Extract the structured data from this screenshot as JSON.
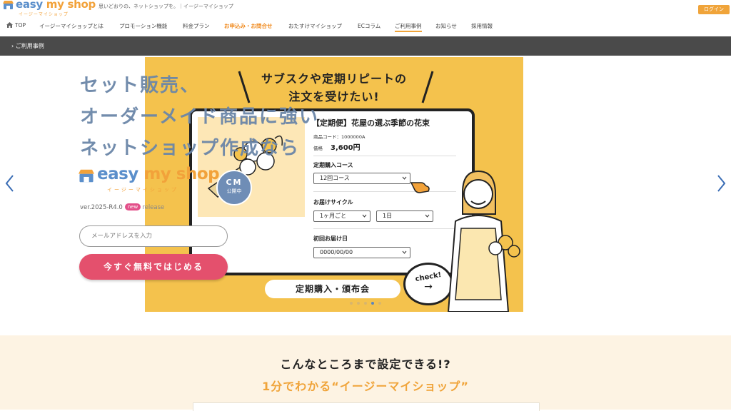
{
  "header": {
    "logo_text_a": "easy",
    "logo_text_b": "my shop",
    "logo_sub": "イージーマイショップ",
    "tagline": "思いどおりの、ネットショップを。｜イージーマイショップ",
    "login_label": "ログイン"
  },
  "nav": {
    "items": [
      {
        "label": "TOP"
      },
      {
        "label": "イージーマイショップとは"
      },
      {
        "label": "プロモーション機能"
      },
      {
        "label": "料金プラン"
      },
      {
        "label": "お申込み・お問合せ"
      },
      {
        "label": "おたすけマイショップ"
      },
      {
        "label": "ECコラム"
      },
      {
        "label": "ご利用事例"
      },
      {
        "label": "お知らせ"
      },
      {
        "label": "採用情報"
      }
    ],
    "active": "ご利用事例"
  },
  "breadcrumb": {
    "label": "ご利用事例"
  },
  "hero": {
    "title_lines": [
      "セット販売、",
      "オーダーメイド商品に強い",
      "ネットショップ作成なら"
    ],
    "logo_text_a": "easy",
    "logo_text_b": "my shop",
    "logo_sub": "イージーマイショップ",
    "version": "ver.2025-R4.0",
    "new_badge": "new",
    "release": "release",
    "email_placeholder": "メールアドレスを入力",
    "cta_label": "今すぐ無料ではじめる"
  },
  "banner": {
    "headline_1": "サブスクや定期リピートの",
    "headline_2": "注文を受けたい!",
    "card_title": "【定期便】花屋の選ぶ季節の花束",
    "product_code": "商品コード：1000000A",
    "price_label": "価格",
    "price": "3,600円",
    "course_label": "定期購入コース",
    "course_value": "12回コース",
    "cycle_label": "お届けサイクル",
    "cycle_value": "1ヶ月ごと",
    "day_value": "1日",
    "first_delivery_label": "初回お届け日",
    "first_delivery_value": "0000/00/00",
    "cm_badge_1": "CM",
    "cm_badge_2": "公開中",
    "plan_pill": "定期購入・頒布会",
    "check_label": "check!",
    "check_arrow": "→",
    "slide_count": 5,
    "active_slide": 4
  },
  "promo": {
    "title": "こんなところまで設定できる!?",
    "subtitle": "1分でわかる“イージーマイショップ”"
  },
  "colors": {
    "brand_blue": "#5b8fcb",
    "brand_orange": "#f2a23a",
    "cta_pink": "#e4506d",
    "banner_yellow": "#f4c24d",
    "breadcrumb_bg": "#4a4a4a",
    "promo_bg": "#fdf3e3"
  }
}
